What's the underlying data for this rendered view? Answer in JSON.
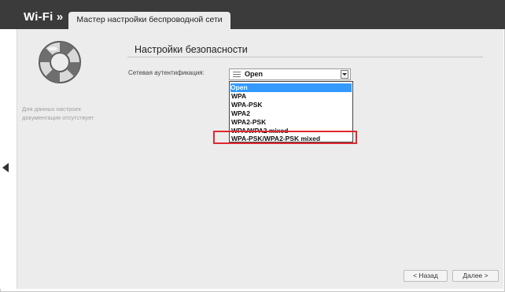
{
  "header": {
    "brand": "Wi-Fi »",
    "tab_label": "Мастер настройки беспроводной сети"
  },
  "sidebar": {
    "no_docs_text": "Для данных настроек документация отсутствует"
  },
  "main": {
    "section_title": "Настройки безопасности",
    "auth_label": "Сетевая аутентификация:",
    "auth_select": {
      "selected": "Open",
      "options": [
        "Open",
        "WPA",
        "WPA-PSK",
        "WPA2",
        "WPA2-PSK",
        "WPA/WPA2 mixed",
        "WPA-PSK/WPA2-PSK mixed"
      ]
    }
  },
  "footer": {
    "back_label": "< Назад",
    "next_label": "Далее >"
  },
  "colors": {
    "header_bg": "#3b3b3b",
    "content_bg": "#ececec",
    "selection": "#3399ff",
    "highlight": "#e0282f"
  },
  "icons": [
    "lifebuoy-icon",
    "collapse-arrow-icon",
    "list-icon",
    "chevron-down-icon"
  ]
}
